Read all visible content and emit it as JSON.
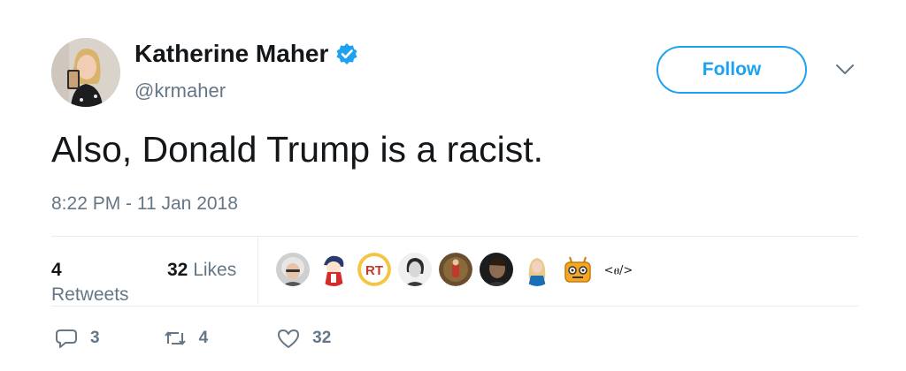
{
  "author": {
    "name": "Katherine Maher",
    "handle": "@krmaher",
    "verified": true
  },
  "follow_label": "Follow",
  "tweet": {
    "text": "Also, Donald Trump is a racist.",
    "timestamp": "8:22 PM - 11 Jan 2018"
  },
  "stats": {
    "retweets_count": "4",
    "retweets_label": "Retweets",
    "likes_count": "32",
    "likes_label": "Likes"
  },
  "likers": [
    {
      "icon": "avatar-grey-hair"
    },
    {
      "icon": "avatar-anime"
    },
    {
      "icon": "avatar-rt-logo",
      "text": "RT"
    },
    {
      "icon": "avatar-bw-portrait"
    },
    {
      "icon": "avatar-red-figure"
    },
    {
      "icon": "avatar-dark-portrait"
    },
    {
      "icon": "avatar-blonde-woman"
    },
    {
      "icon": "avatar-orange-robot"
    },
    {
      "icon": "avatar-code-tag",
      "text": "<ፀ/>"
    }
  ],
  "actions": {
    "replies": "3",
    "retweets": "4",
    "likes": "32"
  },
  "colors": {
    "accent": "#1da1f2",
    "secondary_text": "#657786",
    "divider": "#e6ecf0"
  }
}
